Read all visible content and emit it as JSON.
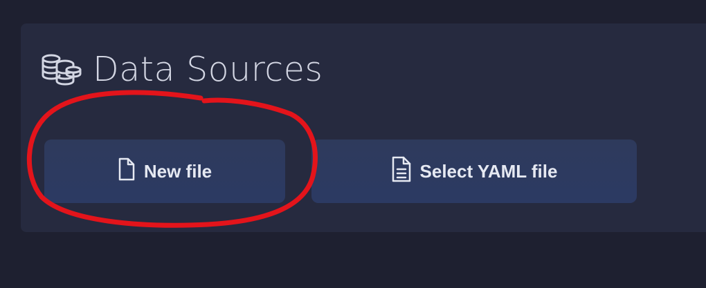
{
  "panel": {
    "title": "Data Sources",
    "title_icon": "coins-database-icon"
  },
  "buttons": {
    "new_file": {
      "label": "New file",
      "icon": "file-icon"
    },
    "select_yaml": {
      "label": "Select YAML file",
      "icon": "file-text-icon"
    }
  },
  "annotation": {
    "shape": "red-circle",
    "color": "#e3141b",
    "target": "new-file-button"
  }
}
